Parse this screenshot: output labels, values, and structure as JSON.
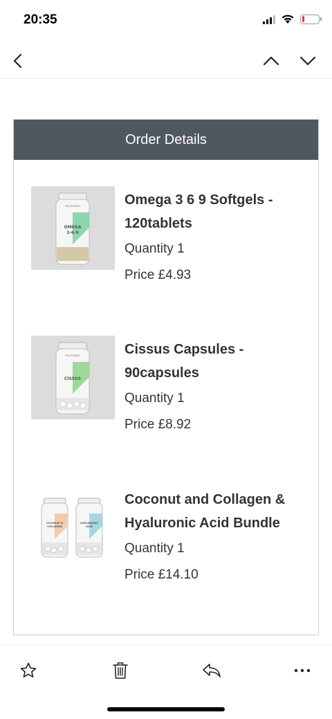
{
  "status_bar": {
    "time": "20:35",
    "icons": [
      "signal-icon",
      "wifi-icon",
      "battery-low-icon"
    ],
    "battery_level": 0.15,
    "battery_color": "#e23b2e"
  },
  "nav": {
    "icons": [
      "chevron-left-icon",
      "chevron-up-icon",
      "chevron-down-icon"
    ]
  },
  "order": {
    "header": "Order Details",
    "header_color": "#4f5760",
    "items": [
      {
        "name": "Omega 3 6 9 Softgels - 120tablets",
        "quantity": "Quantity 1",
        "price": "Price £4.93",
        "image_label": "OMEGA 3-6-9",
        "accent": "#7ccfa3"
      },
      {
        "name": "Cissus Capsules - 90capsules",
        "quantity": "Quantity 1",
        "price": "Price £8.92",
        "image_label": "CISSUS",
        "accent": "#8fd48a"
      },
      {
        "name": "Coconut and Collagen & Hyaluronic Acid Bundle",
        "quantity": "Quantity 1",
        "price": "Price £14.10",
        "image_labels": [
          "COCONUT & COLLAGEN",
          "HYALURONIC ACID"
        ],
        "accents": [
          "#f0c8a5",
          "#9fd3e0"
        ]
      }
    ]
  },
  "toolbar": {
    "icons": [
      "star-icon",
      "trash-icon",
      "reply-icon",
      "more-icon"
    ]
  }
}
